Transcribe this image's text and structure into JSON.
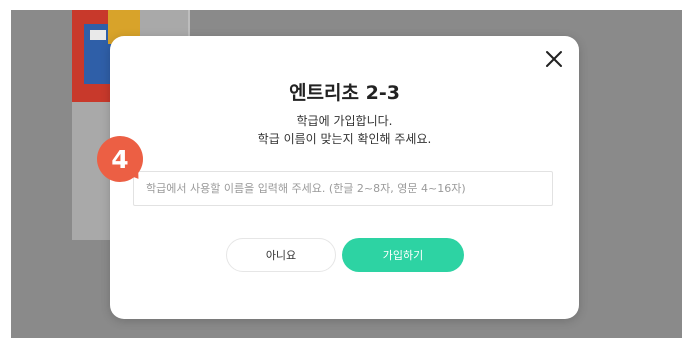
{
  "modal": {
    "title": "엔트리초 2-3",
    "description_line1": "학급에 가입합니다.",
    "description_line2": "학급 이름이 맞는지 확인해 주세요.",
    "input_placeholder": "학급에서 사용할 이름을 입력해 주세요. (한글 2~8자, 영문 4~16자)",
    "input_value": "",
    "no_button_label": "아니요",
    "join_button_label": "가입하기",
    "close_icon": "close-icon"
  },
  "step_badge": {
    "number": "4",
    "color": "#ec5f44"
  },
  "colors": {
    "accent": "#2dd3a3",
    "overlay": "#8a8a8a"
  }
}
